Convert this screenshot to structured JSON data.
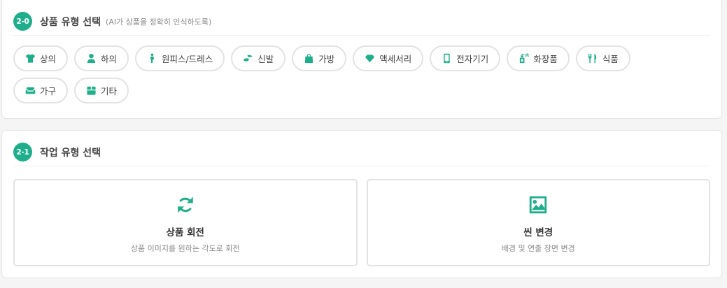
{
  "category_section": {
    "step": "2-0",
    "title": "상품 유형 선택",
    "subtitle": "(AI가 상품을 정확히 인식하도록)",
    "options": [
      {
        "label": "상의",
        "icon": "shirt-icon"
      },
      {
        "label": "하의",
        "icon": "person-icon"
      },
      {
        "label": "원피스/드레스",
        "icon": "dress-icon"
      },
      {
        "label": "신발",
        "icon": "shoe-icon"
      },
      {
        "label": "가방",
        "icon": "bag-icon"
      },
      {
        "label": "액세서리",
        "icon": "gem-icon"
      },
      {
        "label": "전자기기",
        "icon": "phone-icon"
      },
      {
        "label": "화장품",
        "icon": "spray-icon"
      },
      {
        "label": "식품",
        "icon": "utensils-icon"
      },
      {
        "label": "가구",
        "icon": "couch-icon"
      },
      {
        "label": "기타",
        "icon": "box-icon"
      }
    ]
  },
  "task_section": {
    "step": "2-1",
    "title": "작업 유형 선택",
    "options": [
      {
        "title": "상품 회전",
        "description": "상품 이미지를 원하는 각도로 회전",
        "icon": "rotate-icon"
      },
      {
        "title": "씬 변경",
        "description": "배경 및 연출 장면 변경",
        "icon": "image-icon"
      }
    ]
  },
  "colors": {
    "accent": "#1fae8b",
    "border": "#e3e3e3",
    "background": "#f5f5f5"
  }
}
